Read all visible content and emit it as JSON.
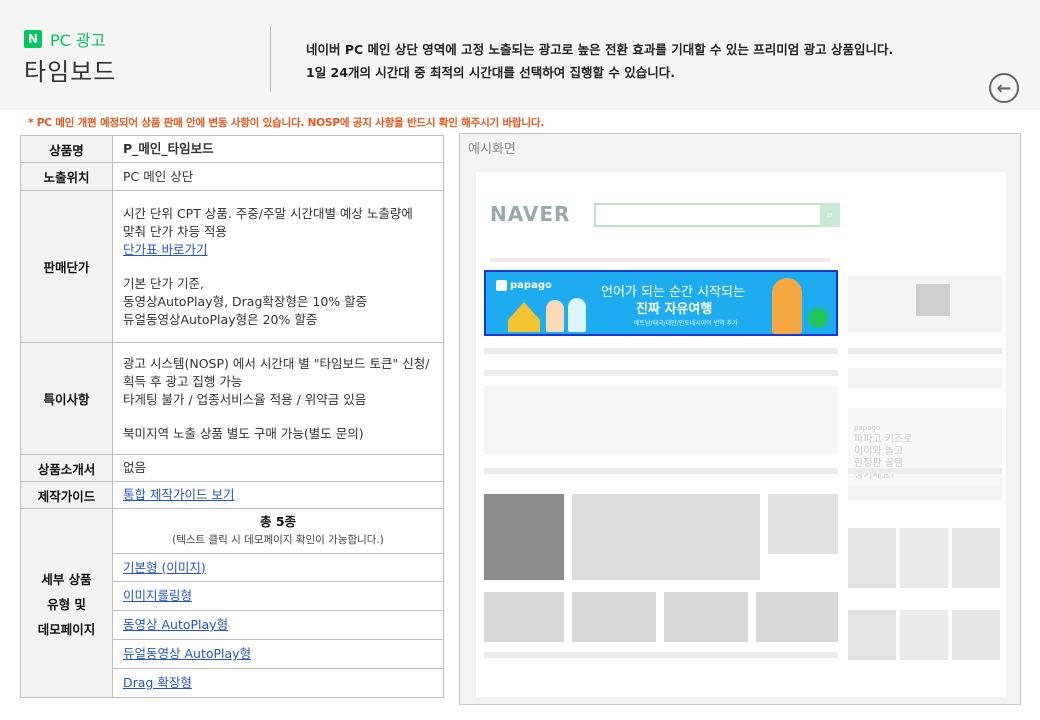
{
  "header": {
    "brand_logo": "N",
    "brand_label": "PC 광고",
    "product_name": "타임보드",
    "desc_line1": "네이버 PC 메인 상단 영역에 고정 노출되는 광고로 높은 전환 효과를 기대할 수 있는 프리미엄 광고 상품입니다.",
    "desc_line2": "1일 24개의 시간대 중 최적의 시간대를 선택하여 집행할 수 있습니다.",
    "back_icon": "circle-arrow-left-icon",
    "back_glyph": "←"
  },
  "notice": "* PC 메인 개편 예정되어 상품 판매 안에 변동 사항이 있습니다. NOSP에 공지 사항을 반드시 확인 해주시기 바랍니다.",
  "spec": {
    "name_label": "상품명",
    "name_value": "P_메인_타임보드",
    "position_label": "노출위치",
    "position_value": "PC 메인 상단",
    "price_label": "판매단가",
    "price_line1": "시간 단위 CPT 상품. 주중/주말 시간대별 예상 노출량에",
    "price_line2": "맞춰 단가 차등 적용",
    "price_link": "단가표 바로가기",
    "price_line3": "기본 단가 기준,",
    "price_line4": "동영상AutoPlay형, Drag확장형은 10% 할증",
    "price_line5": "듀얼동영상AutoPlay형은 20% 할증",
    "special_label": "특이사항",
    "special_line1": "광고 시스템(NOSP) 에서 시간대 별 \"타임보드 토큰\" 신청/",
    "special_line2": "획득 후 광고 집행 가능",
    "special_line3": "타게팅 불가 / 업종서비스율 적용 / 위약금 있음",
    "special_line4": "북미지역 노출 상품 별도 구매 가능(별도 문의)",
    "intro_label": "상품소개서",
    "intro_value": "없음",
    "guide_label": "제작가이드",
    "guide_link": "통합 제작가이드 보기",
    "types_label_1": "세부 상품",
    "types_label_2": "유형 및",
    "types_label_3": "데모페이지",
    "types_total": "총 5종",
    "types_hint": "(텍스트 클릭 시 데모페이지 확인이 가능합니다.)",
    "types": [
      "기본형 (이미지)",
      "이미지롤링형",
      "동영상 AutoPlay형",
      "듀얼동영상 AutoPlay형",
      "Drag 확장형"
    ]
  },
  "example": {
    "title": "예시화면",
    "logo": "NAVER",
    "search_icon": "search-icon",
    "search_glyph": "⌕",
    "ad_brand": "papago",
    "ad_line1": "언어가 되는 순간 시작되는",
    "ad_line2": "진짜 자유여행",
    "ad_line3": "베트남/태국/대만/인도네시아어 번역 추가",
    "side_brand": "papago",
    "side_line1": "파파고 키즈로",
    "side_line2": "이이와 놀고",
    "side_line3": "한정판 꿀템",
    "side_line4": "챙기세요!"
  },
  "colors": {
    "brand_green": "#03c75a",
    "notice_orange": "#e8551a",
    "link_blue": "#2255cc",
    "ad_border": "#1a35d6",
    "ad_bg": "#1dacf0"
  }
}
